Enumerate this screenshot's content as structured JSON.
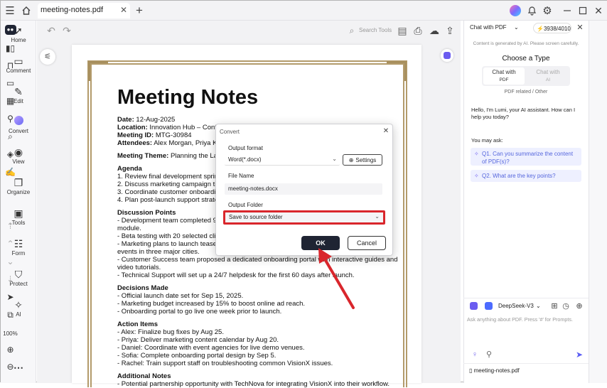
{
  "titlebar": {
    "tab_label": "meeting-notes.pdf",
    "menu_icon": "hamburger-icon",
    "home_icon": "home-icon"
  },
  "leftnav": [
    {
      "label": "Home",
      "icon": "home-nav-icon"
    },
    {
      "label": "Comment",
      "icon": "comment-icon"
    },
    {
      "label": "Edit",
      "icon": "edit-icon"
    },
    {
      "label": "Convert",
      "icon": "convert-icon"
    },
    {
      "label": "View",
      "icon": "view-icon"
    },
    {
      "label": "Organize",
      "icon": "organize-icon"
    },
    {
      "label": "Tools",
      "icon": "tools-icon"
    },
    {
      "label": "Form",
      "icon": "form-icon"
    },
    {
      "label": "Protect",
      "icon": "protect-icon"
    },
    {
      "label": "AI",
      "icon": "ai-icon"
    }
  ],
  "toolbar": {
    "search_label": "Search Tools"
  },
  "document": {
    "title": "Meeting Notes",
    "date_label": "Date:",
    "date_value": " 12-Aug-2025",
    "location_label": "Location:",
    "location_value": " Innovation Hub – Confere",
    "meeting_id_label": "Meeting ID:",
    "meeting_id_value": " MTG-30984",
    "attendees_label": "Attendees:",
    "attendees_value": " Alex Morgan, Priya Kap",
    "theme_label": "Meeting Theme:",
    "theme_value": " Planning the Laun",
    "agenda_heading": "Agenda",
    "agenda": [
      "1. Review final development sprint p",
      "2. Discuss marketing campaign tim",
      "3. Coordinate customer onboardin",
      "4. Plan post-launch support strateg"
    ],
    "discussion_heading": "Discussion Points",
    "discussion": [
      "- Development team completed 95",
      "module.",
      "- Beta testing with 20 selected cli",
      "- Marketing plans to launch teaser",
      "events in three major cities.",
      "- Customer Success team proposed a dedicated onboarding portal with interactive guides and",
      "video tutorials.",
      "- Technical Support will set up a 24/7 helpdesk for the first 60 days after launch."
    ],
    "decisions_heading": "Decisions Made",
    "decisions": [
      "- Official launch date set for Sep 15, 2025.",
      "- Marketing budget increased by 15% to boost online ad reach.",
      "- Onboarding portal to go live one week prior to launch."
    ],
    "actions_heading": "Action Items",
    "actions": [
      "- Alex: Finalize bug fixes by Aug 25.",
      "- Priya: Deliver marketing content calendar by Aug 20.",
      "- Daniel: Coordinate with event agencies for live demo venues.",
      "- Sofia: Complete onboarding portal design by Sep 5.",
      "- Rachel: Train support staff on troubleshooting common VisionX issues."
    ],
    "notes_heading": "Additional Notes",
    "notes": [
      "- Potential partnership opportunity with TechNova for integrating VisionX into their workflow."
    ]
  },
  "dialog": {
    "title": "Convert",
    "output_format_label": "Output format",
    "output_format_value": "Word(*.docx)",
    "settings_label": "Settings",
    "file_name_label": "File Name",
    "file_name_value": "meeting-notes.docx",
    "output_folder_label": "Output Folder",
    "output_folder_value": "Save to source folder",
    "ok_label": "OK",
    "cancel_label": "Cancel",
    "highlight_color": "#d9262c"
  },
  "chat": {
    "header_label": "Chat with PDF",
    "credits": "3938/4010",
    "notice": "Content is generated by AI. Please screen carefully.",
    "choose_type": "Choose a Type",
    "type_pdf": "Chat with",
    "type_pdf_sub": "PDF",
    "type_ai": "Chat with",
    "type_ai_sub": "AI",
    "type_caption": "PDF related / Other",
    "greeting": "Hello, I'm Lumi, your AI assistant. How can I help you today?",
    "you_may_ask": "You may ask:",
    "q1": "Q1. Can you summarize the content of PDF(s)?",
    "q2": "Q2. What are the key points?",
    "model": "DeepSeek-V3",
    "input_placeholder": "Ask anything about PDF. Press '#' for Prompts.",
    "attached_file": "meeting-notes.pdf"
  },
  "rightbar": {
    "zoom": "100%"
  },
  "colors": {
    "accent": "#5b5ef4",
    "ok_button": "#1f2433",
    "frame": "#b39b6b",
    "arrow": "#d9262c"
  }
}
